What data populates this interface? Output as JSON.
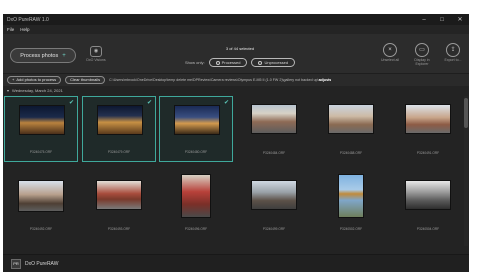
{
  "window": {
    "title": "DxO PureRAW 1.0",
    "minimize": "–",
    "maximize": "□",
    "close": "✕"
  },
  "menu": {
    "file": "File",
    "help": "Help"
  },
  "toolbar": {
    "process_label": "Process photos",
    "process_icon": "+",
    "dxo_vision_label": "DxO Visions",
    "selected_count": "3 of 44 selected",
    "show_only_label": "Show only:",
    "filter_processed": "Processed",
    "filter_unprocessed": "Unprocessed",
    "right_tools": [
      {
        "label": "Unselect all",
        "icon": "×"
      },
      {
        "label": "Display in Explorer",
        "icon": "▭"
      },
      {
        "label": "Export to...",
        "icon": "⇪"
      }
    ]
  },
  "pathbar": {
    "add_label": "Add photos to process",
    "clear_label": "Clear thumbnails",
    "path": "C:\\Users\\mbrock\\OneDrive\\Desktop\\temp delete me\\DPReview\\Camera reviews\\Olympus E-M5 II (1.0 FW 2)\\gallery not backed up\\",
    "path_bold": "adjusts"
  },
  "group": {
    "date": "Wednesday, March 24, 2021"
  },
  "thumbnails": [
    {
      "file": "P3240475.ORF",
      "selected": true
    },
    {
      "file": "P3240479.ORF",
      "selected": true
    },
    {
      "file": "P3240480.ORF",
      "selected": true
    },
    {
      "file": "P3240484.ORF",
      "selected": false
    },
    {
      "file": "P3240488.ORF",
      "selected": false
    },
    {
      "file": "P3240491.ORF",
      "selected": false
    },
    {
      "file": "P3240492.ORF",
      "selected": false
    },
    {
      "file": "P3240493.ORF",
      "selected": false
    },
    {
      "file": "P3240496.ORF",
      "selected": false
    },
    {
      "file": "P3240499.ORF",
      "selected": false
    },
    {
      "file": "P3240502.ORF",
      "selected": false
    },
    {
      "file": "P3240504.ORF",
      "selected": false
    }
  ],
  "footer": {
    "logo_text": "PR",
    "app_name": "DxO PureRAW"
  }
}
